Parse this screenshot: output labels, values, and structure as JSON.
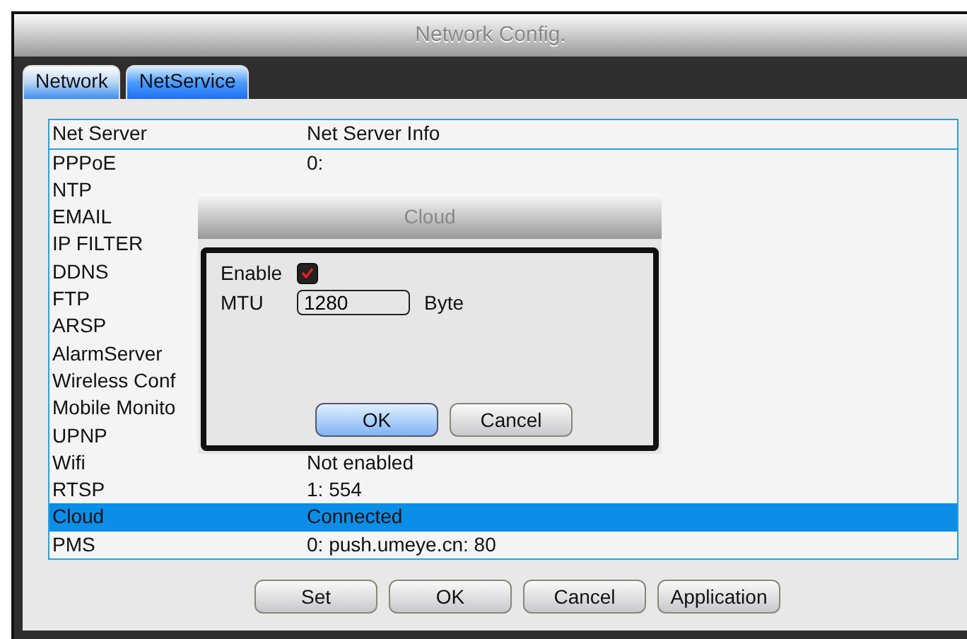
{
  "window": {
    "title": "Network Config."
  },
  "tabs": [
    {
      "label": "Network",
      "selected": false
    },
    {
      "label": "NetService",
      "selected": true
    }
  ],
  "table": {
    "columns": [
      "Net Server",
      "Net Server Info"
    ],
    "rows": [
      {
        "name": "PPPoE",
        "info": "0:",
        "selected": false
      },
      {
        "name": "NTP",
        "selected": false
      },
      {
        "name": "EMAIL",
        "selected": false
      },
      {
        "name": "IP FILTER",
        "selected": false
      },
      {
        "name": "DDNS",
        "selected": false
      },
      {
        "name": "FTP",
        "selected": false
      },
      {
        "name": "ARSP",
        "selected": false
      },
      {
        "name": "AlarmServer",
        "selected": false
      },
      {
        "name": "Wireless Conf",
        "selected": false
      },
      {
        "name": "Mobile Monito",
        "selected": false
      },
      {
        "name": "UPNP",
        "selected": false
      },
      {
        "name": "Wifi",
        "info": "Not enabled",
        "selected": false
      },
      {
        "name": "RTSP",
        "info": "1: 554",
        "selected": false
      },
      {
        "name": "Cloud",
        "info": "Connected",
        "selected": true
      },
      {
        "name": "PMS",
        "info": "0: push.umeye.cn: 80",
        "selected": false
      }
    ]
  },
  "buttons": [
    "Set",
    "OK",
    "Cancel",
    "Application"
  ],
  "dialog": {
    "title": "Cloud",
    "enable_label": "Enable",
    "enabled": true,
    "mtu_label": "MTU",
    "mtu_value": "1280",
    "mtu_unit": "Byte",
    "buttons": [
      {
        "label": "OK",
        "selected": true
      },
      {
        "label": "Cancel",
        "selected": false
      }
    ]
  }
}
